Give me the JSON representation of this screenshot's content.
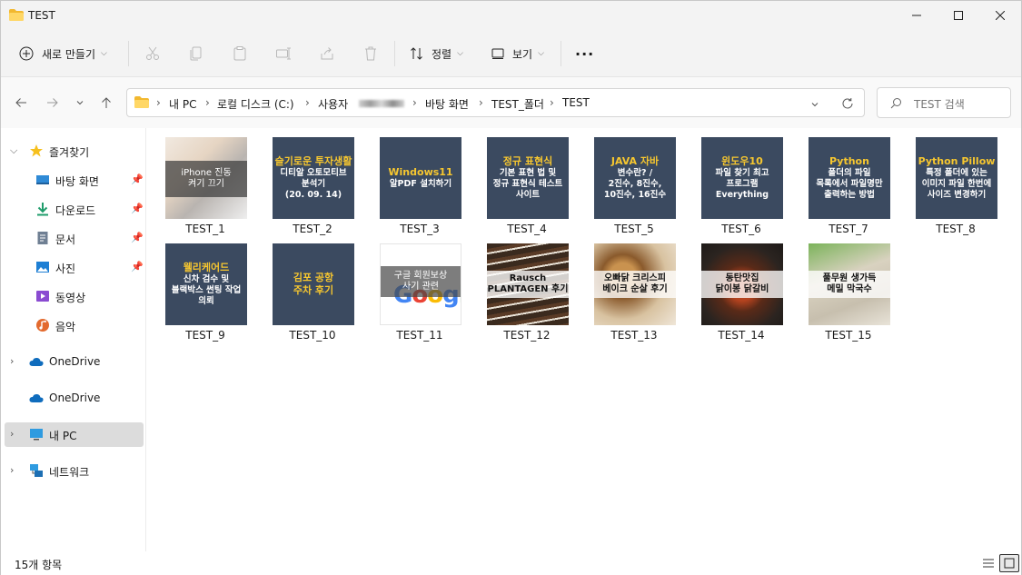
{
  "window": {
    "title": "TEST"
  },
  "toolbar": {
    "new_label": "새로 만들기",
    "sort_label": "정렬",
    "view_label": "보기",
    "more_label": "···"
  },
  "address": {
    "crumbs": [
      "내 PC",
      "로컬 디스크 (C:)",
      "사용자",
      "",
      "바탕 화면",
      "TEST_폴더",
      "TEST"
    ]
  },
  "search": {
    "placeholder": "TEST 검색"
  },
  "sidebar": {
    "quick_access": "즐겨찾기",
    "items": [
      {
        "label": "바탕 화면",
        "icon": "desktop-icon"
      },
      {
        "label": "다운로드",
        "icon": "download-icon"
      },
      {
        "label": "문서",
        "icon": "document-icon"
      },
      {
        "label": "사진",
        "icon": "pictures-icon"
      },
      {
        "label": "동영상",
        "icon": "video-icon"
      },
      {
        "label": "음악",
        "icon": "music-icon"
      }
    ],
    "onedrive1": "OneDrive",
    "onedrive2": "OneDrive",
    "this_pc": "내 PC",
    "network": "네트워크"
  },
  "files": [
    {
      "name": "TEST_1",
      "kind": "photo",
      "lines": [
        "iPhone 진동",
        "켜기 끄기"
      ]
    },
    {
      "name": "TEST_2",
      "kind": "card",
      "headline": [
        "슬기로운 투자생활"
      ],
      "lines": [
        "디티알 오토모티브",
        "분석기",
        "(20. 09. 14)"
      ]
    },
    {
      "name": "TEST_3",
      "kind": "card",
      "headline": [
        "Windows11"
      ],
      "lines": [
        "알PDF 설치하기"
      ]
    },
    {
      "name": "TEST_4",
      "kind": "card",
      "headline": [
        "정규 표현식"
      ],
      "lines": [
        "기본 표현 법 및",
        "정규 표현식 테스트",
        "사이트"
      ]
    },
    {
      "name": "TEST_5",
      "kind": "card",
      "headline": [
        "JAVA 자바"
      ],
      "lines": [
        "변수란? /",
        "2진수, 8진수,",
        "10진수, 16진수"
      ]
    },
    {
      "name": "TEST_6",
      "kind": "card",
      "headline": [
        "윈도우10"
      ],
      "lines": [
        "파일 찾기 최고",
        "프로그램",
        "Everything"
      ]
    },
    {
      "name": "TEST_7",
      "kind": "card",
      "headline": [
        "Python"
      ],
      "lines": [
        "폴더의 파일",
        "목록에서 파일명만",
        "출력하는 방법"
      ]
    },
    {
      "name": "TEST_8",
      "kind": "card",
      "headline": [
        "Python Pillow"
      ],
      "lines": [
        "특정 폴더에 있는",
        "이미지 파일 한번에",
        "사이즈 변경하기"
      ]
    },
    {
      "name": "TEST_9",
      "kind": "card",
      "headline": [
        "웰리케어드"
      ],
      "lines": [
        "신차 검수 및",
        "블랙박스 썬팅 작업",
        "의뢰"
      ]
    },
    {
      "name": "TEST_10",
      "kind": "card",
      "headline": [
        "김포 공항",
        "주차 후기"
      ],
      "lines": []
    },
    {
      "name": "TEST_11",
      "kind": "photo-light",
      "lines": [
        "구글 회원보상",
        "사기 관련"
      ]
    },
    {
      "name": "TEST_12",
      "kind": "photo-light",
      "lines": [
        "Rausch",
        "PLANTAGEN 후기"
      ]
    },
    {
      "name": "TEST_13",
      "kind": "photo-light",
      "lines": [
        "오빠닭 크리스피",
        "베이크 순살 후기"
      ]
    },
    {
      "name": "TEST_14",
      "kind": "photo-light",
      "lines": [
        "동탄맛집",
        "닭이봉 닭갈비"
      ]
    },
    {
      "name": "TEST_15",
      "kind": "photo-light",
      "lines": [
        "풀무원 생가득",
        "메밀 막국수"
      ]
    }
  ],
  "status": {
    "count": "15개 항목"
  }
}
